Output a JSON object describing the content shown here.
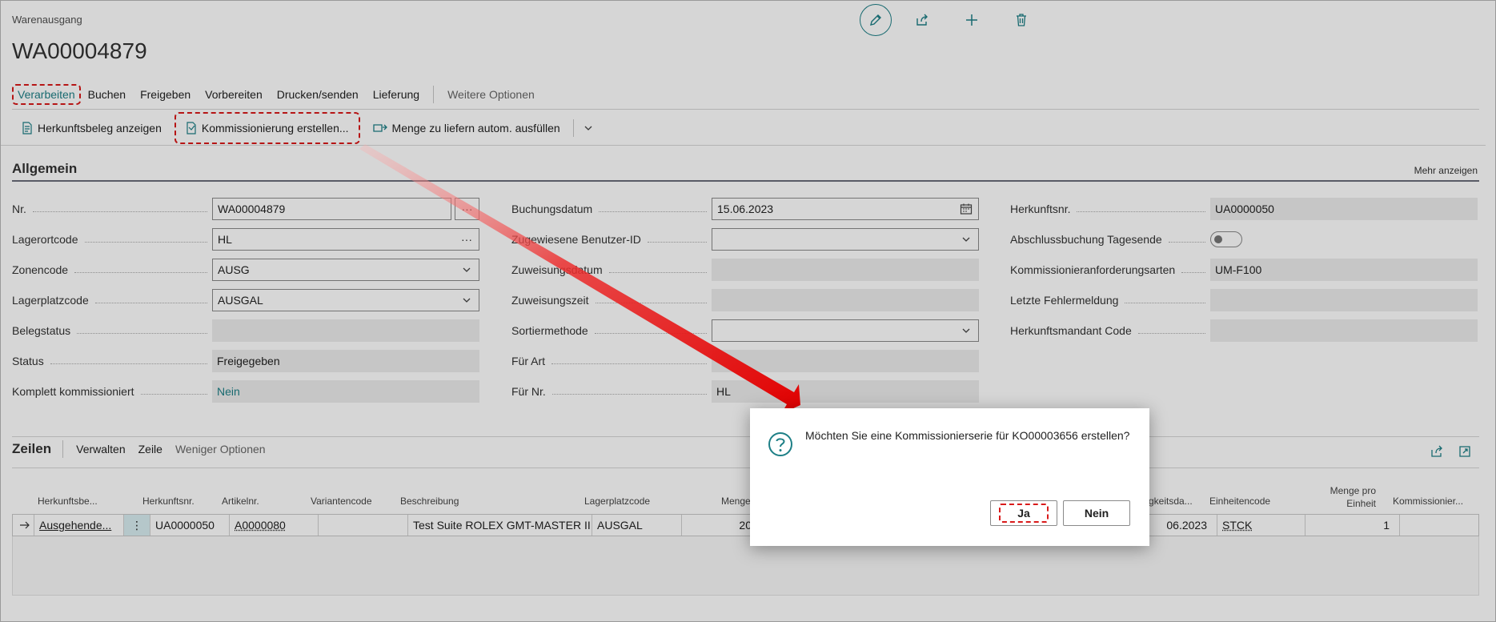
{
  "header": {
    "doc_type": "Warenausgang",
    "doc_no": "WA00004879"
  },
  "top_actions": [
    "pencil-icon",
    "share-icon",
    "plus-icon",
    "trash-icon"
  ],
  "action_bar": {
    "items": [
      "Verarbeiten",
      "Buchen",
      "Freigeben",
      "Vorbereiten",
      "Drucken/senden",
      "Lieferung"
    ],
    "more": "Weitere Optionen"
  },
  "subbar": {
    "show_source": "Herkunftsbeleg anzeigen",
    "create_pick": "Kommissionierung erstellen...",
    "autofill": "Menge zu liefern autom. ausfüllen"
  },
  "general": {
    "title": "Allgemein",
    "show_more": "Mehr anzeigen",
    "col1": [
      {
        "label": "Nr.",
        "value": "WA00004879"
      },
      {
        "label": "Lagerortcode",
        "value": "HL"
      },
      {
        "label": "Zonencode",
        "value": "AUSG"
      },
      {
        "label": "Lagerplatzcode",
        "value": "AUSGAL"
      },
      {
        "label": "Belegstatus",
        "value": ""
      },
      {
        "label": "Status",
        "value": "Freigegeben"
      },
      {
        "label": "Komplett kommissioniert",
        "value": "Nein"
      }
    ],
    "col2": [
      {
        "label": "Buchungsdatum",
        "value": "15.06.2023"
      },
      {
        "label": "Zugewiesene Benutzer-ID",
        "value": ""
      },
      {
        "label": "Zuweisungsdatum",
        "value": ""
      },
      {
        "label": "Zuweisungszeit",
        "value": ""
      },
      {
        "label": "Sortiermethode",
        "value": ""
      },
      {
        "label": "Für Art",
        "value": ""
      },
      {
        "label": "Für Nr.",
        "value": "HL"
      }
    ],
    "col3": [
      {
        "label": "Herkunftsnr.",
        "value": "UA0000050"
      },
      {
        "label": "Abschlussbuchung Tagesende",
        "value": ""
      },
      {
        "label": "Kommissionieranforderungsarten",
        "value": "UM-F100"
      },
      {
        "label": "Letzte Fehlermeldung",
        "value": ""
      },
      {
        "label": "Herkunftsmandant Code",
        "value": ""
      }
    ]
  },
  "lines": {
    "title": "Zeilen",
    "actions": [
      "Verwalten",
      "Zeile"
    ],
    "fewer": "Weniger Optionen",
    "columns": [
      "Herkunftsbe...",
      "Herkunftsnr.",
      "Artikelnr.",
      "Variantencode",
      "Beschreibung",
      "Lagerplatzcode",
      "Menge",
      "gkeitsda...",
      "Einheitencode",
      "Menge pro Einheit",
      "Kommissionier..."
    ],
    "row": {
      "source_doc": "Ausgehende...",
      "source_no": "UA0000050",
      "item_no": "A0000080",
      "variant": "",
      "description": "Test Suite ROLEX GMT-MASTER II",
      "bin": "AUSGAL",
      "qty": "20",
      "date": "06.2023",
      "uom": "STCK",
      "qty_per_uom": "1",
      "pick": ""
    }
  },
  "dialog": {
    "message": "Möchten Sie eine Kommissionierserie für KO00003656 erstellen?",
    "yes": "Ja",
    "no": "Nein"
  }
}
